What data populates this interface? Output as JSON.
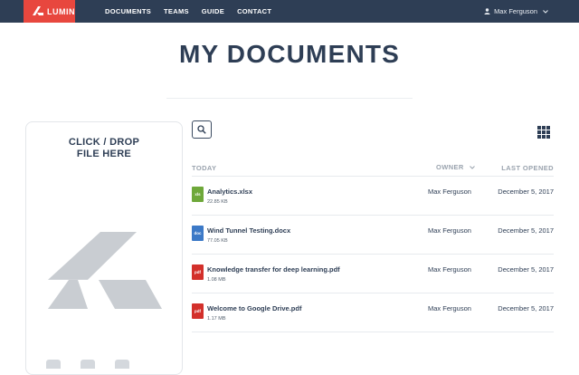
{
  "app": {
    "brand": "LUMIN"
  },
  "nav": {
    "links": [
      "DOCUMENTS",
      "TEAMS",
      "GUIDE",
      "CONTACT"
    ],
    "user_name": "Max Ferguson"
  },
  "page": {
    "title": "MY DOCUMENTS"
  },
  "dropzone": {
    "label_line1": "CLICK / DROP",
    "label_line2": "FILE HERE"
  },
  "list": {
    "group_label": "TODAY",
    "owner_header": "OWNER",
    "last_opened_header": "LAST OPENED",
    "files": [
      {
        "icon": "xlsx",
        "type": "xls",
        "name": "Analytics.xlsx",
        "size": "22.85 KB",
        "owner": "Max Ferguson",
        "last_opened": "December 5, 2017"
      },
      {
        "icon": "docx",
        "type": "doc",
        "name": "Wind Tunnel Testing.docx",
        "size": "77.05 KB",
        "owner": "Max Ferguson",
        "last_opened": "December 5, 2017"
      },
      {
        "icon": "pdf",
        "type": "pdf",
        "name": "Knowledge transfer for deep learning.pdf",
        "size": "1.08 MB",
        "owner": "Max Ferguson",
        "last_opened": "December 5, 2017"
      },
      {
        "icon": "pdf",
        "type": "pdf",
        "name": "Welcome to Google Drive.pdf",
        "size": "1.17 MB",
        "owner": "Max Ferguson",
        "last_opened": "December 5, 2017"
      }
    ]
  },
  "colors": {
    "nav_bg": "#2e3e55",
    "brand_red": "#e8473e",
    "xlsx": "#6ea83a",
    "docx": "#3c79c7",
    "pdf": "#d3302b"
  }
}
